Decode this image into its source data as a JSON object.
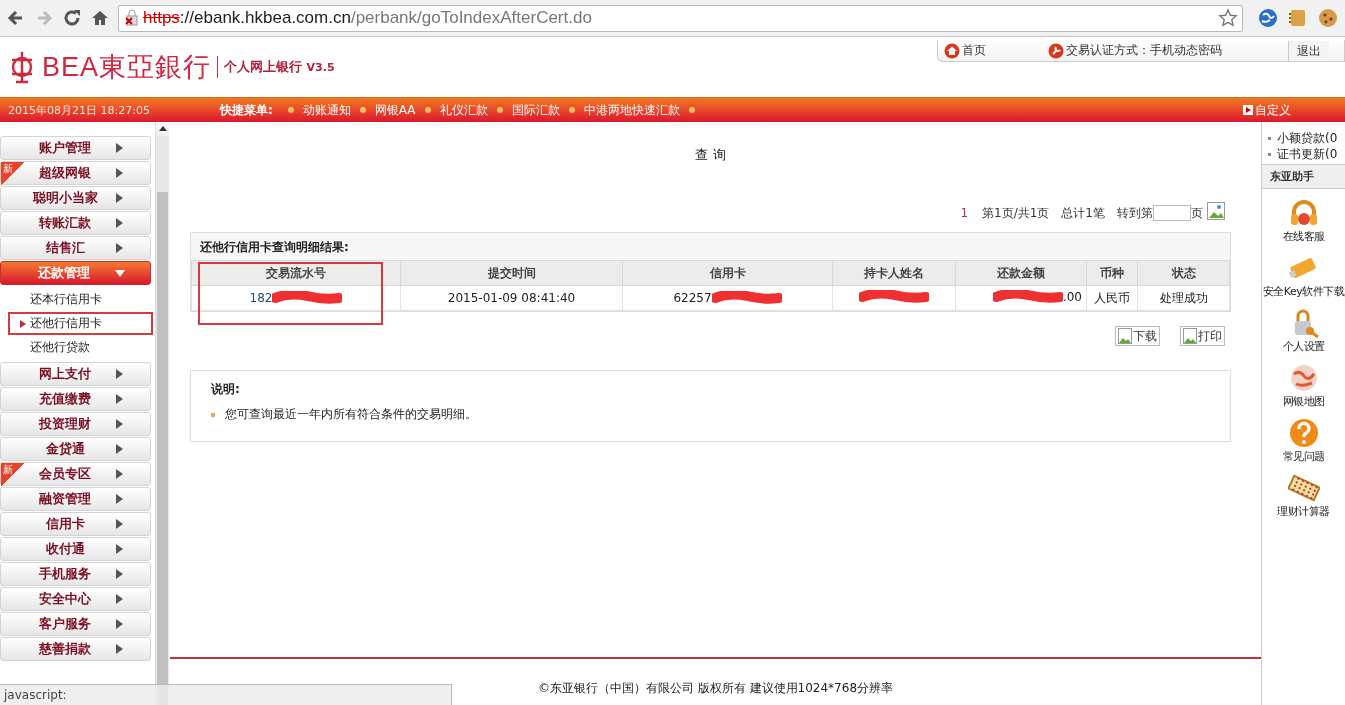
{
  "browser": {
    "url_scheme": "https",
    "url_host": "://ebank.hkbea.com.cn",
    "url_path": "/perbank/goToIndexAfterCert.do",
    "status": "javascript:"
  },
  "header": {
    "logo": "BEA東亞銀行",
    "product": "个人网上银行",
    "version": "V3.5",
    "links": [
      {
        "kind": "home",
        "label": "首页"
      },
      {
        "kind": "auth",
        "label": "交易认证方式：手机动态密码"
      }
    ],
    "logout": "退出"
  },
  "quickbar": {
    "datetime": "2015年08月21日 18:27:05",
    "title": "快捷菜单:",
    "items": [
      "动账通知",
      "网银AA",
      "礼仪汇款",
      "国际汇款",
      "中港两地快速汇款"
    ],
    "customize": "自定义"
  },
  "menu": [
    {
      "label": "账户管理",
      "expanded": false
    },
    {
      "label": "超级网银",
      "badge": "新",
      "expanded": false
    },
    {
      "label": "聪明小当家",
      "expanded": false
    },
    {
      "label": "转账汇款",
      "expanded": false
    },
    {
      "label": "结售汇",
      "expanded": false
    },
    {
      "label": "还款管理",
      "expanded": true,
      "children": [
        {
          "label": "还本行信用卡",
          "selected": false,
          "highlighted": false
        },
        {
          "label": "还他行信用卡",
          "selected": true,
          "highlighted": true
        },
        {
          "label": "还他行贷款",
          "selected": false,
          "highlighted": false
        }
      ]
    },
    {
      "label": "网上支付",
      "expanded": false
    },
    {
      "label": "充值缴费",
      "expanded": false
    },
    {
      "label": "投资理财",
      "expanded": false
    },
    {
      "label": "金贷通",
      "expanded": false
    },
    {
      "label": "会员专区",
      "badge": "新",
      "expanded": false
    },
    {
      "label": "融资管理",
      "expanded": false
    },
    {
      "label": "信用卡",
      "expanded": false
    },
    {
      "label": "收付通",
      "expanded": false
    },
    {
      "label": "手机服务",
      "expanded": false
    },
    {
      "label": "安全中心",
      "expanded": false
    },
    {
      "label": "客户服务",
      "expanded": false
    },
    {
      "label": "慈善捐款",
      "expanded": false
    }
  ],
  "main": {
    "title": "查 询",
    "pager": {
      "current": "1",
      "pages": "第1页/共1页",
      "total": "总计1笔",
      "goto": "转到第",
      "unit": "页"
    },
    "table": {
      "title": "还他行信用卡查询明细结果:",
      "columns": [
        {
          "label": "交易流水号",
          "highlighted": true
        },
        {
          "label": "提交时间",
          "highlighted": false
        },
        {
          "label": "信用卡",
          "highlighted": false
        },
        {
          "label": "持卡人姓名",
          "highlighted": false
        },
        {
          "label": "还款金额",
          "highlighted": false
        },
        {
          "label": "币种",
          "highlighted": false
        },
        {
          "label": "状态",
          "highlighted": false
        }
      ],
      "rows": [
        [
          {
            "text": "182",
            "redacted": true
          },
          {
            "text": "2015-01-09 08:41:40",
            "redacted": false
          },
          {
            "text": "62257",
            "redacted": true
          },
          {
            "redacted": true
          },
          {
            "text": ".00",
            "redacted": true
          },
          {
            "text": "人民币",
            "redacted": false
          },
          {
            "text": "处理成功",
            "redacted": false
          }
        ]
      ]
    },
    "actions": [
      "下载",
      "打印"
    ],
    "note": {
      "title": "说明:",
      "items": [
        "您可查询最近一年内所有符合条件的交易明细。"
      ]
    },
    "footer": "©东亚银行（中国）有限公司 版权所有 建议使用1024*768分辨率"
  },
  "assistant": {
    "notices": [
      "小额贷款(0",
      "证书更新(0"
    ],
    "title": "东亚助手",
    "tools": [
      {
        "kind": "headset",
        "label": "在线客服"
      },
      {
        "kind": "usbkey",
        "label": "安全Key软件下载"
      },
      {
        "kind": "lock",
        "label": "个人设置"
      },
      {
        "kind": "globe",
        "label": "网银地图"
      },
      {
        "kind": "help",
        "label": "常见问题"
      },
      {
        "kind": "abacus",
        "label": "理财计算器"
      }
    ]
  }
}
